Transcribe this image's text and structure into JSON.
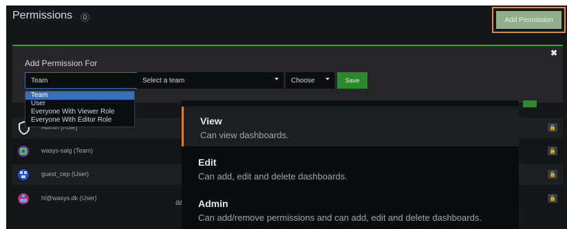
{
  "header": {
    "title": "Permissions",
    "help_glyph": "⓪",
    "add_permission_label": "Add Permission"
  },
  "form": {
    "label": "Add Permission For",
    "close_glyph": "✖",
    "type_select_value": "Team",
    "team_select_value": "Select a team",
    "permission_select_value": "Choose",
    "save_label": "Save"
  },
  "type_menu": {
    "options": [
      "Team",
      "User",
      "Everyone With Viewer Role",
      "Everyone With Editor Role"
    ],
    "selected_index": 0
  },
  "rows": [
    {
      "label": "Admin (Role)"
    },
    {
      "label": "wasys-salg (Team)"
    },
    {
      "label": "guest_cep (User)"
    },
    {
      "label": "hl@wasys.dk (User)"
    }
  ],
  "permission_menu": {
    "items": [
      {
        "name": "View",
        "description": "Can view dashboards."
      },
      {
        "name": "Edit",
        "description": "Can add, edit and delete dashboards."
      },
      {
        "name": "Admin",
        "description": "Can add/remove permissions and can add, edit and delete dashboards."
      }
    ],
    "active_index": 0
  },
  "stray_text": "ar",
  "colors": {
    "accent_orange": "#eb7b18",
    "save_green": "#2c8a2c",
    "selection_blue": "#3572b9"
  }
}
